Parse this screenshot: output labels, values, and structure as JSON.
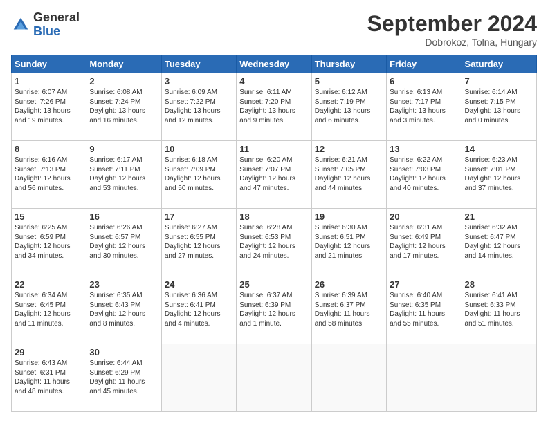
{
  "header": {
    "logo_general": "General",
    "logo_blue": "Blue",
    "month_title": "September 2024",
    "subtitle": "Dobrokoz, Tolna, Hungary"
  },
  "weekdays": [
    "Sunday",
    "Monday",
    "Tuesday",
    "Wednesday",
    "Thursday",
    "Friday",
    "Saturday"
  ],
  "weeks": [
    [
      {
        "day": "1",
        "lines": [
          "Sunrise: 6:07 AM",
          "Sunset: 7:26 PM",
          "Daylight: 13 hours",
          "and 19 minutes."
        ]
      },
      {
        "day": "2",
        "lines": [
          "Sunrise: 6:08 AM",
          "Sunset: 7:24 PM",
          "Daylight: 13 hours",
          "and 16 minutes."
        ]
      },
      {
        "day": "3",
        "lines": [
          "Sunrise: 6:09 AM",
          "Sunset: 7:22 PM",
          "Daylight: 13 hours",
          "and 12 minutes."
        ]
      },
      {
        "day": "4",
        "lines": [
          "Sunrise: 6:11 AM",
          "Sunset: 7:20 PM",
          "Daylight: 13 hours",
          "and 9 minutes."
        ]
      },
      {
        "day": "5",
        "lines": [
          "Sunrise: 6:12 AM",
          "Sunset: 7:19 PM",
          "Daylight: 13 hours",
          "and 6 minutes."
        ]
      },
      {
        "day": "6",
        "lines": [
          "Sunrise: 6:13 AM",
          "Sunset: 7:17 PM",
          "Daylight: 13 hours",
          "and 3 minutes."
        ]
      },
      {
        "day": "7",
        "lines": [
          "Sunrise: 6:14 AM",
          "Sunset: 7:15 PM",
          "Daylight: 13 hours",
          "and 0 minutes."
        ]
      }
    ],
    [
      {
        "day": "8",
        "lines": [
          "Sunrise: 6:16 AM",
          "Sunset: 7:13 PM",
          "Daylight: 12 hours",
          "and 56 minutes."
        ]
      },
      {
        "day": "9",
        "lines": [
          "Sunrise: 6:17 AM",
          "Sunset: 7:11 PM",
          "Daylight: 12 hours",
          "and 53 minutes."
        ]
      },
      {
        "day": "10",
        "lines": [
          "Sunrise: 6:18 AM",
          "Sunset: 7:09 PM",
          "Daylight: 12 hours",
          "and 50 minutes."
        ]
      },
      {
        "day": "11",
        "lines": [
          "Sunrise: 6:20 AM",
          "Sunset: 7:07 PM",
          "Daylight: 12 hours",
          "and 47 minutes."
        ]
      },
      {
        "day": "12",
        "lines": [
          "Sunrise: 6:21 AM",
          "Sunset: 7:05 PM",
          "Daylight: 12 hours",
          "and 44 minutes."
        ]
      },
      {
        "day": "13",
        "lines": [
          "Sunrise: 6:22 AM",
          "Sunset: 7:03 PM",
          "Daylight: 12 hours",
          "and 40 minutes."
        ]
      },
      {
        "day": "14",
        "lines": [
          "Sunrise: 6:23 AM",
          "Sunset: 7:01 PM",
          "Daylight: 12 hours",
          "and 37 minutes."
        ]
      }
    ],
    [
      {
        "day": "15",
        "lines": [
          "Sunrise: 6:25 AM",
          "Sunset: 6:59 PM",
          "Daylight: 12 hours",
          "and 34 minutes."
        ]
      },
      {
        "day": "16",
        "lines": [
          "Sunrise: 6:26 AM",
          "Sunset: 6:57 PM",
          "Daylight: 12 hours",
          "and 30 minutes."
        ]
      },
      {
        "day": "17",
        "lines": [
          "Sunrise: 6:27 AM",
          "Sunset: 6:55 PM",
          "Daylight: 12 hours",
          "and 27 minutes."
        ]
      },
      {
        "day": "18",
        "lines": [
          "Sunrise: 6:28 AM",
          "Sunset: 6:53 PM",
          "Daylight: 12 hours",
          "and 24 minutes."
        ]
      },
      {
        "day": "19",
        "lines": [
          "Sunrise: 6:30 AM",
          "Sunset: 6:51 PM",
          "Daylight: 12 hours",
          "and 21 minutes."
        ]
      },
      {
        "day": "20",
        "lines": [
          "Sunrise: 6:31 AM",
          "Sunset: 6:49 PM",
          "Daylight: 12 hours",
          "and 17 minutes."
        ]
      },
      {
        "day": "21",
        "lines": [
          "Sunrise: 6:32 AM",
          "Sunset: 6:47 PM",
          "Daylight: 12 hours",
          "and 14 minutes."
        ]
      }
    ],
    [
      {
        "day": "22",
        "lines": [
          "Sunrise: 6:34 AM",
          "Sunset: 6:45 PM",
          "Daylight: 12 hours",
          "and 11 minutes."
        ]
      },
      {
        "day": "23",
        "lines": [
          "Sunrise: 6:35 AM",
          "Sunset: 6:43 PM",
          "Daylight: 12 hours",
          "and 8 minutes."
        ]
      },
      {
        "day": "24",
        "lines": [
          "Sunrise: 6:36 AM",
          "Sunset: 6:41 PM",
          "Daylight: 12 hours",
          "and 4 minutes."
        ]
      },
      {
        "day": "25",
        "lines": [
          "Sunrise: 6:37 AM",
          "Sunset: 6:39 PM",
          "Daylight: 12 hours",
          "and 1 minute."
        ]
      },
      {
        "day": "26",
        "lines": [
          "Sunrise: 6:39 AM",
          "Sunset: 6:37 PM",
          "Daylight: 11 hours",
          "and 58 minutes."
        ]
      },
      {
        "day": "27",
        "lines": [
          "Sunrise: 6:40 AM",
          "Sunset: 6:35 PM",
          "Daylight: 11 hours",
          "and 55 minutes."
        ]
      },
      {
        "day": "28",
        "lines": [
          "Sunrise: 6:41 AM",
          "Sunset: 6:33 PM",
          "Daylight: 11 hours",
          "and 51 minutes."
        ]
      }
    ],
    [
      {
        "day": "29",
        "lines": [
          "Sunrise: 6:43 AM",
          "Sunset: 6:31 PM",
          "Daylight: 11 hours",
          "and 48 minutes."
        ]
      },
      {
        "day": "30",
        "lines": [
          "Sunrise: 6:44 AM",
          "Sunset: 6:29 PM",
          "Daylight: 11 hours",
          "and 45 minutes."
        ]
      },
      null,
      null,
      null,
      null,
      null
    ]
  ]
}
